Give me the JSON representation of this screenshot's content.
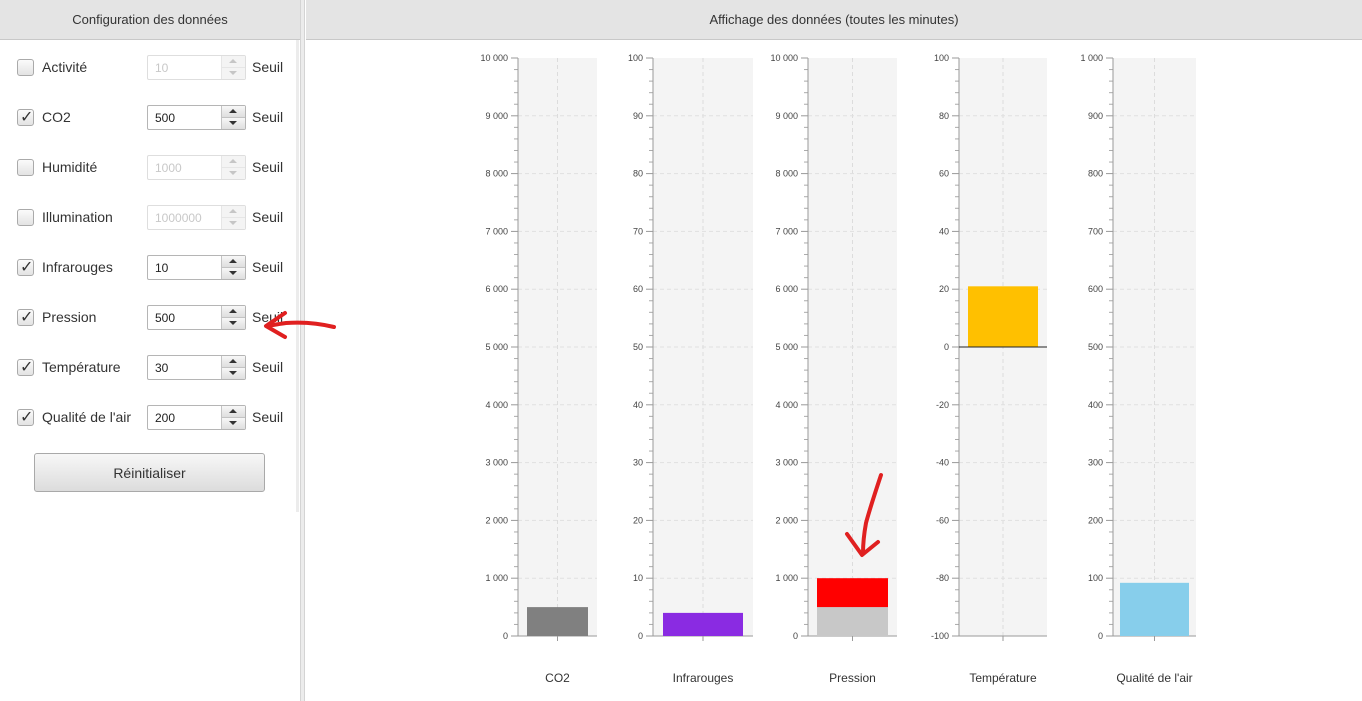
{
  "left_panel": {
    "title": "Configuration des données",
    "rows": [
      {
        "label": "Activité",
        "checked": false,
        "value": "10",
        "seuil": "Seuil"
      },
      {
        "label": "CO2",
        "checked": true,
        "value": "500",
        "seuil": "Seuil"
      },
      {
        "label": "Humidité",
        "checked": false,
        "value": "1000",
        "seuil": "Seuil"
      },
      {
        "label": "Illumination",
        "checked": false,
        "value": "1000000",
        "seuil": "Seuil"
      },
      {
        "label": "Infrarouges",
        "checked": true,
        "value": "10",
        "seuil": "Seuil"
      },
      {
        "label": "Pression",
        "checked": true,
        "value": "500",
        "seuil": "Seuil"
      },
      {
        "label": "Température",
        "checked": true,
        "value": "30",
        "seuil": "Seuil"
      },
      {
        "label": "Qualité de l'air",
        "checked": true,
        "value": "200",
        "seuil": "Seuil"
      }
    ],
    "reset_label": "Réinitialiser"
  },
  "right_panel": {
    "title": "Affichage des données (toutes les minutes)"
  },
  "chart_data": [
    {
      "type": "bar",
      "name_label": "CO2",
      "categories": [
        "CO2"
      ],
      "ylim": [
        0,
        10000
      ],
      "ticks": [
        "0",
        "1 000",
        "2 000",
        "3 000",
        "4 000",
        "5 000",
        "6 000",
        "7 000",
        "8 000",
        "9 000",
        "10 000"
      ],
      "values": [
        500
      ],
      "threshold": null,
      "color": "#808080",
      "grid": true
    },
    {
      "type": "bar",
      "name_label": "Infrarouges",
      "categories": [
        "Infrarouges"
      ],
      "ylim": [
        0,
        100
      ],
      "ticks": [
        "0",
        "10",
        "20",
        "30",
        "40",
        "50",
        "60",
        "70",
        "80",
        "90",
        "100"
      ],
      "values": [
        4
      ],
      "threshold": null,
      "color": "#8a2be2",
      "grid": true
    },
    {
      "type": "bar",
      "name_label": "Pression",
      "categories": [
        "Pression"
      ],
      "ylim": [
        0,
        10000
      ],
      "ticks": [
        "0",
        "1 000",
        "2 000",
        "3 000",
        "4 000",
        "5 000",
        "6 000",
        "7 000",
        "8 000",
        "9 000",
        "10 000"
      ],
      "values": [
        1000
      ],
      "threshold": 500,
      "color": "#ff0000",
      "below_color": "#c8c8c8",
      "grid": true
    },
    {
      "type": "bar",
      "name_label": "Température",
      "categories": [
        "Température"
      ],
      "ylim": [
        -100,
        100
      ],
      "ticks": [
        "-100",
        "-80",
        "-60",
        "-40",
        "-20",
        "0",
        "20",
        "40",
        "60",
        "80",
        "100"
      ],
      "values": [
        21
      ],
      "threshold": null,
      "color": "#ffc000",
      "grid": true
    },
    {
      "type": "bar",
      "name_label": "Qualité de l'air",
      "categories": [
        "Qualité de l'air"
      ],
      "ylim": [
        0,
        1000
      ],
      "ticks": [
        "0",
        "100",
        "200",
        "300",
        "400",
        "500",
        "600",
        "700",
        "800",
        "900",
        "1 000"
      ],
      "values": [
        92
      ],
      "threshold": null,
      "color": "#87ceeb",
      "grid": true
    }
  ],
  "annotation_color": "#e02020"
}
